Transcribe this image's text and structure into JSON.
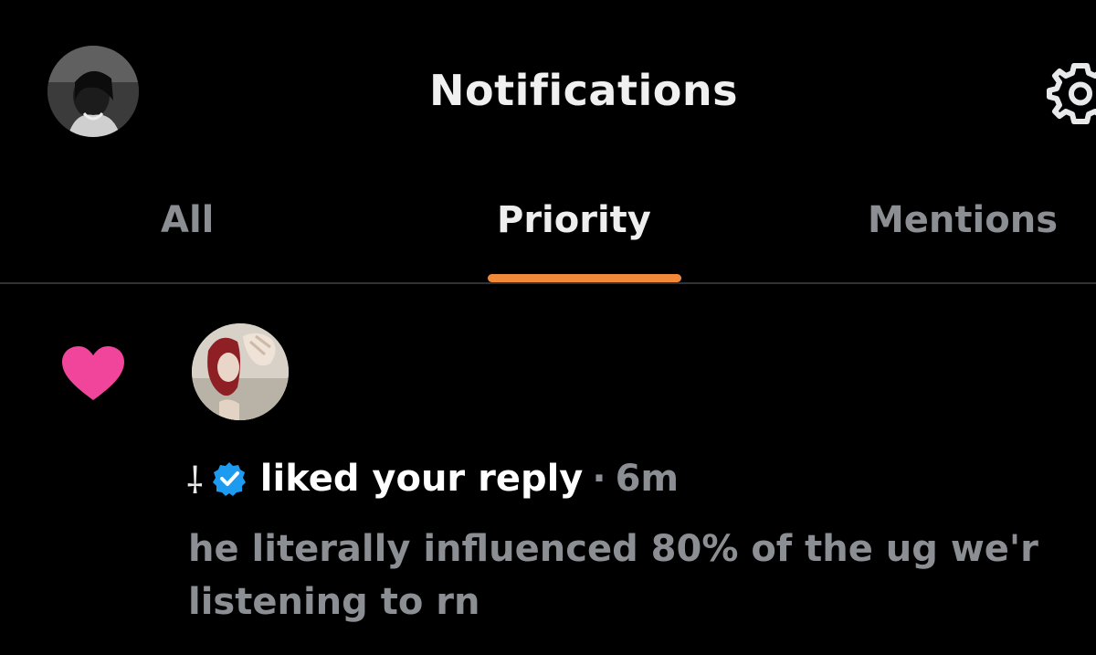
{
  "header": {
    "title": "Notifications",
    "avatar_icon": "profile-avatar",
    "settings_icon": "gear-icon"
  },
  "tabs": [
    {
      "label": "All",
      "active": false
    },
    {
      "label": "Priority",
      "active": true
    },
    {
      "label": "Mentions",
      "active": false
    }
  ],
  "colors": {
    "background": "#000000",
    "tab_indicator": "#f08a3a",
    "heart": "#f0459a",
    "verified": "#1d9bf0",
    "muted_text": "#8b8f93",
    "divider": "#2f3336"
  },
  "notification": {
    "type_icon": "heart-icon",
    "actor_name": "⸸",
    "verified": true,
    "action": "liked your reply",
    "separator": "·",
    "time": "6m",
    "preview_line1": "he literally influenced 80% of the ug we'r",
    "preview_line2": "listening to rn"
  }
}
